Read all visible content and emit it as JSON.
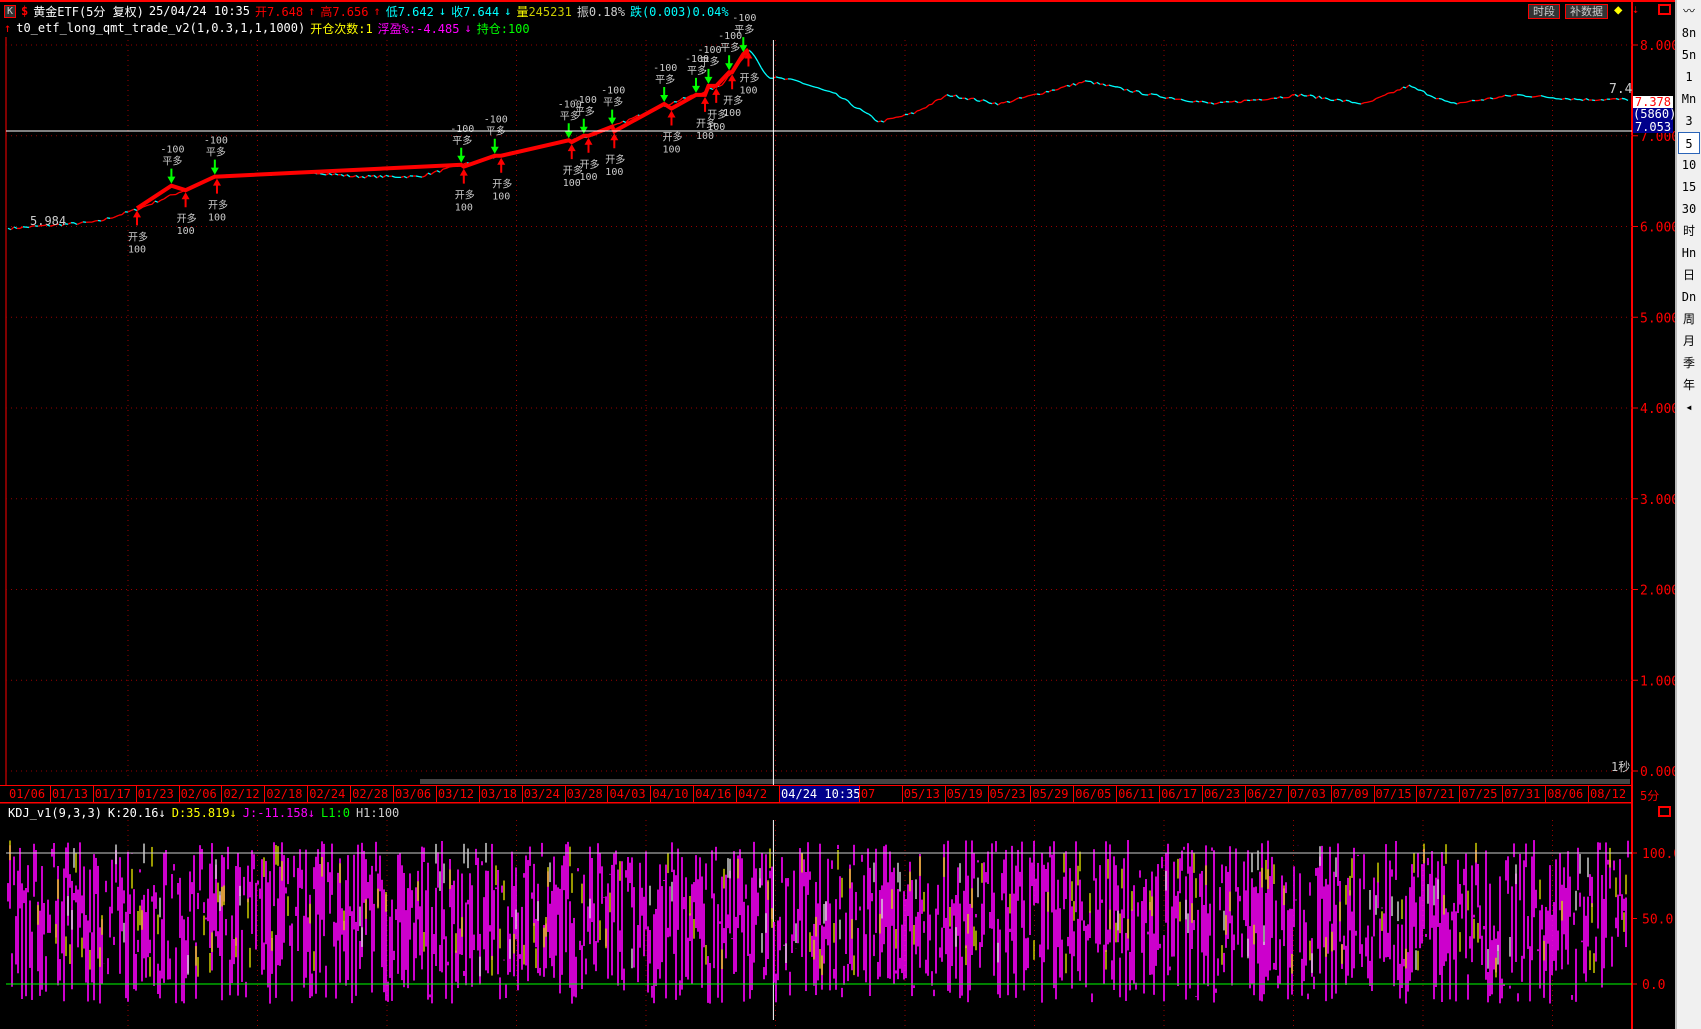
{
  "header": {
    "k_btn": "K",
    "s_icon": "$",
    "title": "黄金ETF(5分 复权)",
    "datetime": "25/04/24 10:35",
    "open": "开7.648",
    "high": "高7.656",
    "low": "低7.642",
    "close": "收7.644",
    "volume_label": "量",
    "volume": "245231",
    "amplitude": "振0.18%",
    "change": "跌(0.003)0.04%"
  },
  "strategy": {
    "name": "t0_etf_long_qmt_trade_v2(1,0.3,1,1,1000)",
    "open_count": "开仓次数:1",
    "float_pnl": "浮盈%:-4.485",
    "position": "持仓:100"
  },
  "buttons": {
    "period": "时段",
    "fill_data": "补数据"
  },
  "price_axis": {
    "labels": [
      "8.000",
      "7.000",
      "6.000",
      "5.000",
      "4.000",
      "3.000",
      "2.000",
      "1.000",
      "0.000"
    ],
    "values": [
      8,
      7,
      6,
      5,
      4,
      3,
      2,
      1,
      0
    ]
  },
  "price_tags": {
    "last": "7.378",
    "count": "(5860)",
    "cursor": "7.053",
    "left_start": "5.984",
    "right_label": "7.4"
  },
  "timer": "1秒",
  "period_label": "5分",
  "dates": [
    "01/06",
    "01/13",
    "01/17",
    "01/23",
    "02/06",
    "02/12",
    "02/18",
    "02/24",
    "02/28",
    "03/06",
    "03/12",
    "03/18",
    "03/24",
    "03/28",
    "04/03",
    "04/10",
    "04/16",
    "04/2",
    "04/24 10:35",
    "07",
    "05/13",
    "05/19",
    "05/23",
    "05/29",
    "06/05",
    "06/11",
    "06/17",
    "06/23",
    "06/27",
    "07/03",
    "07/09",
    "07/15",
    "07/21",
    "07/25",
    "07/31",
    "08/06",
    "08/12"
  ],
  "kdj": {
    "name": "KDJ_v1(9,3,3)",
    "k": "K:20.16",
    "d": "D:35.819",
    "j": "J:-11.158",
    "l1": "L1:0",
    "h1": "H1:100",
    "axis": [
      "100.0",
      "50.0",
      "0.0"
    ]
  },
  "sidebar": [
    "8n",
    "5n",
    "1",
    "Mn",
    "3",
    "5",
    "10",
    "15",
    "30",
    "时",
    "Hn",
    "日",
    "Dn",
    "周",
    "月",
    "季",
    "年"
  ],
  "sidebar_selected": "5",
  "chart_data": {
    "type": "line",
    "price_path": [
      [
        0,
        5.98
      ],
      [
        2,
        6.05
      ],
      [
        3,
        6.2
      ],
      [
        4.8,
        6.55
      ],
      [
        7,
        6.6
      ],
      [
        8,
        6.55
      ],
      [
        9.5,
        6.55
      ],
      [
        10.5,
        6.68
      ],
      [
        12.5,
        6.9
      ],
      [
        13.5,
        7.0
      ],
      [
        15,
        7.3
      ],
      [
        16.5,
        7.55
      ],
      [
        17.2,
        7.95
      ],
      [
        17.6,
        7.65
      ],
      [
        18.3,
        7.6
      ],
      [
        19.2,
        7.45
      ],
      [
        20.2,
        7.15
      ],
      [
        21,
        7.25
      ],
      [
        21.8,
        7.45
      ],
      [
        23,
        7.35
      ],
      [
        25,
        7.6
      ],
      [
        26.5,
        7.45
      ],
      [
        28,
        7.35
      ],
      [
        30,
        7.45
      ],
      [
        31.5,
        7.35
      ],
      [
        32.5,
        7.55
      ],
      [
        33.5,
        7.35
      ],
      [
        35,
        7.45
      ],
      [
        36.5,
        7.4
      ]
    ],
    "trades": [
      {
        "t": 3.0,
        "p": 6.2,
        "side": "open",
        "label": "开多",
        "qty": "100"
      },
      {
        "t": 3.8,
        "p": 6.45,
        "side": "close",
        "label": "平多",
        "qty": "-100"
      },
      {
        "t": 4.13,
        "p": 6.4,
        "side": "open",
        "label": "开多",
        "qty": "100"
      },
      {
        "t": 4.81,
        "p": 6.55,
        "side": "close",
        "label": "平多",
        "qty": "-100"
      },
      {
        "t": 4.86,
        "p": 6.55,
        "side": "open",
        "label": "开多",
        "qty": "100"
      },
      {
        "t": 10.54,
        "p": 6.68,
        "side": "close",
        "label": "平多",
        "qty": "-100"
      },
      {
        "t": 10.6,
        "p": 6.66,
        "side": "open",
        "label": "开多",
        "qty": "100"
      },
      {
        "t": 11.32,
        "p": 6.78,
        "side": "close",
        "label": "平多",
        "qty": "-100"
      },
      {
        "t": 11.47,
        "p": 6.78,
        "side": "open",
        "label": "开多",
        "qty": "100"
      },
      {
        "t": 13.04,
        "p": 6.95,
        "side": "close",
        "label": "平多",
        "qty": "-100"
      },
      {
        "t": 13.11,
        "p": 6.93,
        "side": "open",
        "label": "开多",
        "qty": "100"
      },
      {
        "t": 13.39,
        "p": 7.0,
        "side": "close",
        "label": "平多",
        "qty": "-100"
      },
      {
        "t": 13.5,
        "p": 7.0,
        "side": "open",
        "label": "开多",
        "qty": "100"
      },
      {
        "t": 14.05,
        "p": 7.1,
        "side": "close",
        "label": "平多",
        "qty": "-100"
      },
      {
        "t": 14.1,
        "p": 7.05,
        "side": "open",
        "label": "开多",
        "qty": "100"
      },
      {
        "t": 15.26,
        "p": 7.35,
        "side": "close",
        "label": "平多",
        "qty": "-100"
      },
      {
        "t": 15.43,
        "p": 7.3,
        "side": "open",
        "label": "开多",
        "qty": "100"
      },
      {
        "t": 16.0,
        "p": 7.45,
        "side": "close",
        "label": "平多",
        "qty": "-100"
      },
      {
        "t": 16.21,
        "p": 7.45,
        "side": "open",
        "label": "开多",
        "qty": "100"
      },
      {
        "t": 16.29,
        "p": 7.55,
        "side": "close",
        "label": "平多",
        "qty": "-100"
      },
      {
        "t": 16.47,
        "p": 7.55,
        "side": "open",
        "label": "开多",
        "qty": "100"
      },
      {
        "t": 16.77,
        "p": 7.7,
        "side": "close",
        "label": "平多",
        "qty": "-100"
      },
      {
        "t": 16.84,
        "p": 7.7,
        "side": "open",
        "label": "开多",
        "qty": "100"
      },
      {
        "t": 17.1,
        "p": 7.9,
        "side": "close",
        "label": "平多",
        "qty": "-100"
      },
      {
        "t": 17.22,
        "p": 7.95,
        "side": "open",
        "label": "开多",
        "qty": "100"
      }
    ],
    "cursor": {
      "t": 17.8,
      "price": 7.053
    },
    "kdj_range": [
      0,
      100
    ]
  },
  "colors": {
    "up": "#ff0000",
    "down": "#00ffff",
    "k": "#ffffff",
    "d": "#ffff00",
    "j": "#ff00ff",
    "l1": "#00ff00"
  }
}
